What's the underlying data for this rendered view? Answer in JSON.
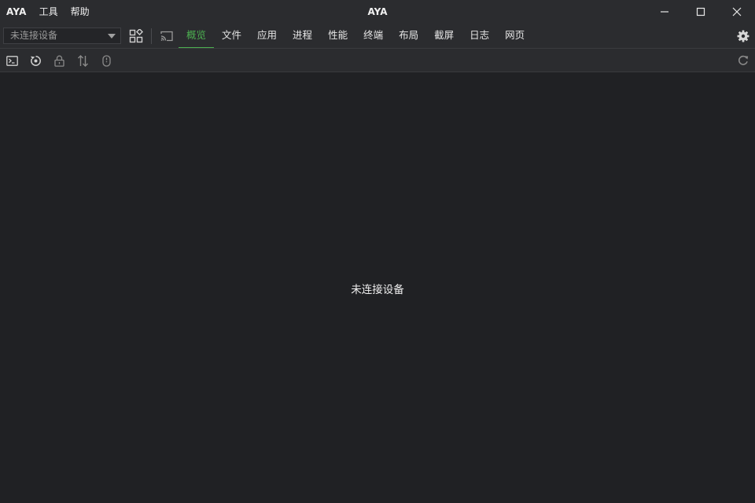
{
  "window": {
    "title": "AYA"
  },
  "menu": {
    "items": [
      {
        "label": "AYA"
      },
      {
        "label": "工具"
      },
      {
        "label": "帮助"
      }
    ]
  },
  "toolbar": {
    "device_select": {
      "value": "未连接设备"
    },
    "tabs": [
      {
        "label": "概览",
        "active": true
      },
      {
        "label": "文件"
      },
      {
        "label": "应用"
      },
      {
        "label": "进程"
      },
      {
        "label": "性能"
      },
      {
        "label": "终端"
      },
      {
        "label": "布局"
      },
      {
        "label": "截屏"
      },
      {
        "label": "日志"
      },
      {
        "label": "网页"
      }
    ],
    "icons": [
      "apps-icon",
      "screencast-icon",
      "settings-icon"
    ]
  },
  "subbar": {
    "icons": [
      "terminal-icon",
      "reboot-icon",
      "lock-icon",
      "transfer-icon",
      "mouse-icon",
      "refresh-icon"
    ]
  },
  "main": {
    "empty_message": "未连接设备"
  },
  "colors": {
    "background": "#202124",
    "bar": "#2b2c2f",
    "accent": "#4caf50",
    "text": "#e8e8e8"
  }
}
